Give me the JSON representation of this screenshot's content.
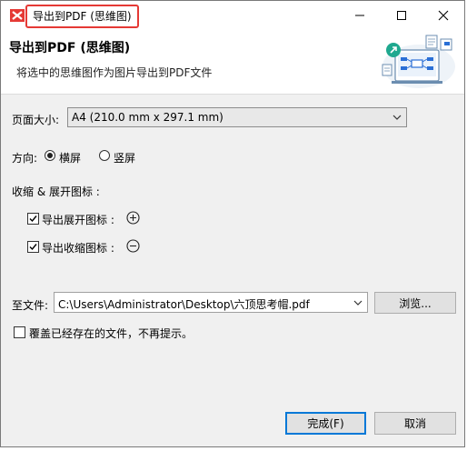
{
  "window": {
    "title": "导出到PDF (思维图)",
    "controls": {
      "minimize": "–",
      "maximize": "□",
      "close": "✕"
    }
  },
  "header": {
    "title": "导出到PDF (思维图)",
    "subtitle": "将选中的思维图作为图片导出到PDF文件"
  },
  "page_size": {
    "label": "页面大小:",
    "value": "A4 (210.0 mm x 297.1 mm)"
  },
  "orientation": {
    "label": "方向:",
    "options": [
      {
        "label": "横屏",
        "selected": true
      },
      {
        "label": "竖屏",
        "selected": false
      }
    ]
  },
  "collapse_expand": {
    "label": "收缩 & 展开图标 :",
    "export_expand": {
      "label": "导出展开图标 :",
      "checked": true,
      "icon": "plus-circle-icon"
    },
    "export_collapse": {
      "label": "导出收缩图标 :",
      "checked": true,
      "icon": "minus-circle-icon"
    }
  },
  "target_file": {
    "label": "至文件:",
    "path": "C:\\Users\\Administrator\\Desktop\\六顶思考帽.pdf",
    "browse_label": "浏览..."
  },
  "overwrite": {
    "label": "覆盖已经存在的文件，不再提示。",
    "checked": false
  },
  "footer": {
    "finish_label": "完成(F)",
    "cancel_label": "取消"
  },
  "colors": {
    "title_highlight": "#e53935",
    "primary_button_border": "#0078d7",
    "app_icon": "#e53935",
    "illustration_accent": "#1fa88f"
  }
}
